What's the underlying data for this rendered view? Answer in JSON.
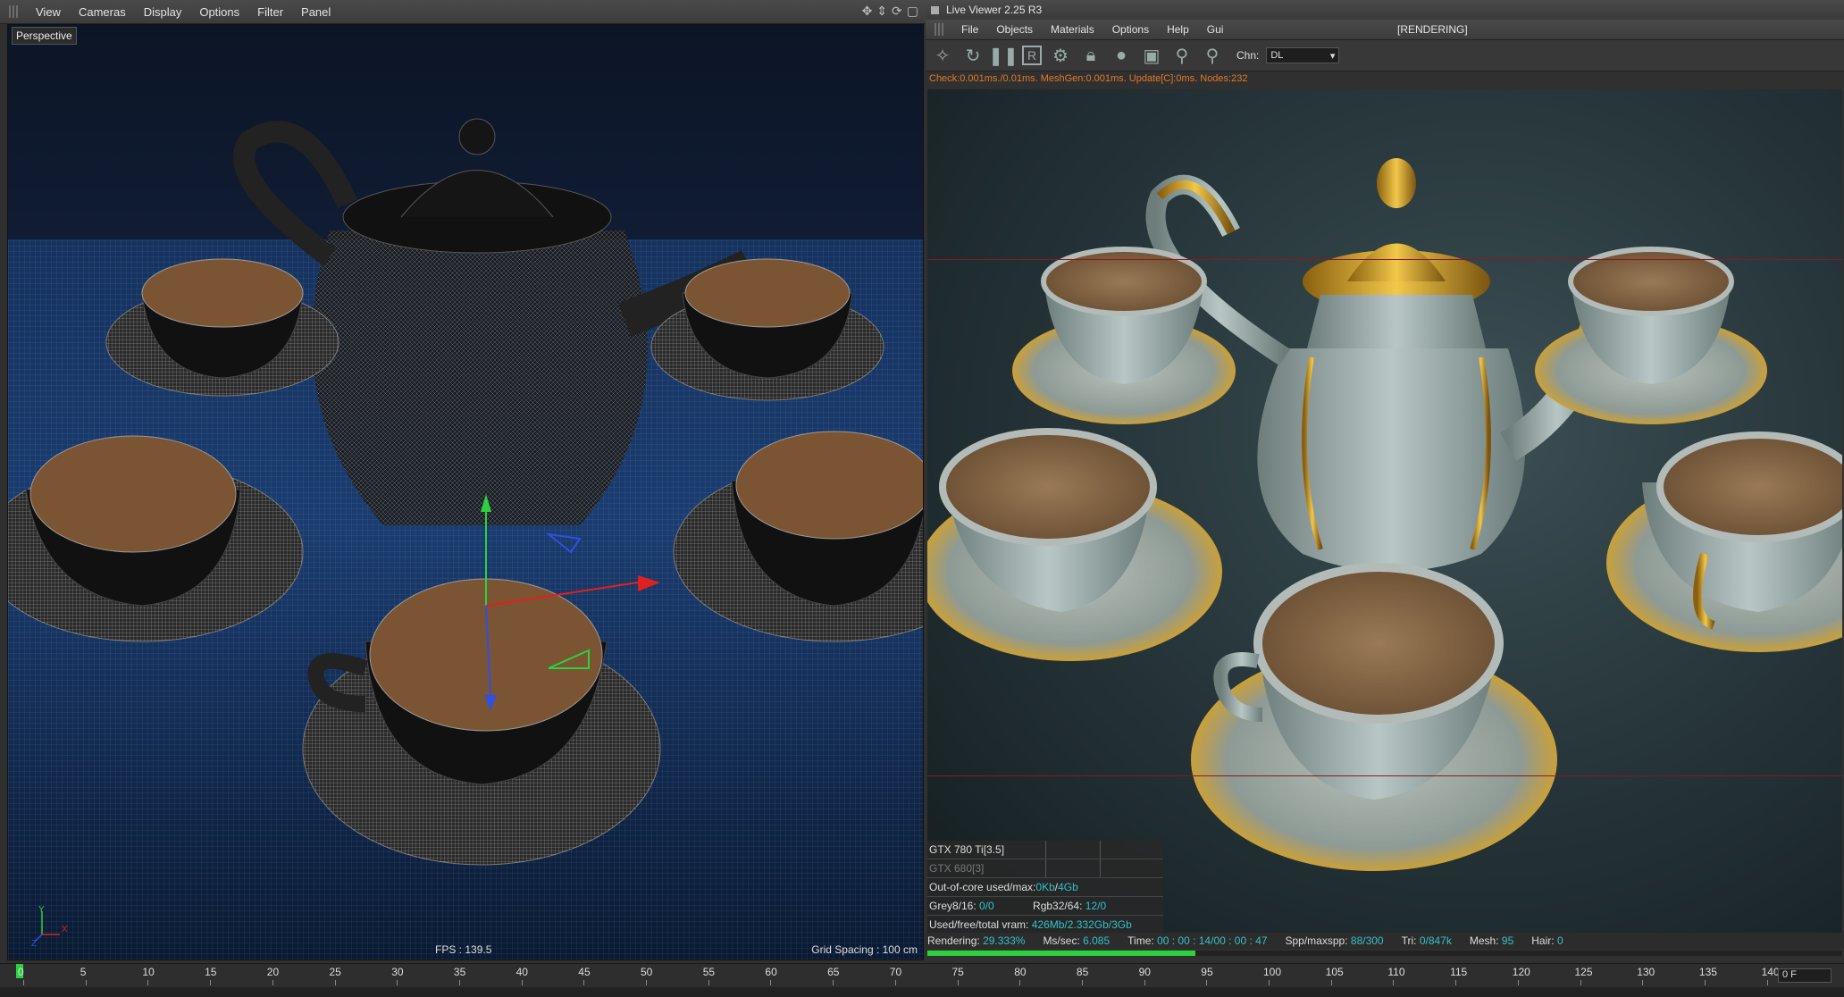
{
  "viewport": {
    "menu": [
      "View",
      "Cameras",
      "Display",
      "Options",
      "Filter",
      "Panel"
    ],
    "label": "Perspective",
    "fps": "FPS : 139.5",
    "grid_spacing": "Grid Spacing : 100 cm",
    "axis_y": "Y",
    "axis_x": "X",
    "axis_z": "Z"
  },
  "live_viewer": {
    "title": "Live Viewer 2.25 R3",
    "menu": [
      "File",
      "Objects",
      "Materials",
      "Options",
      "Help",
      "Gui"
    ],
    "status": "[RENDERING]",
    "chn_label": "Chn:",
    "chn_value": "DL",
    "info_line": "Check:0.001ms./0.01ms. MeshGen:0.001ms. Update[C]:0ms. Nodes:232",
    "gpu": [
      {
        "label": "GTX 780 Ti[3.5]"
      },
      {
        "label": "GTX 680[3]"
      }
    ],
    "mem": {
      "ooc_label": "Out-of-core used/max:",
      "ooc_used": "0Kb",
      "ooc_sep": "/",
      "ooc_max": "4Gb",
      "grey_label": "Grey8/16:",
      "grey_value": "0/0",
      "rgb_label": "Rgb32/64:",
      "rgb_value": "12/0",
      "vram_label": "Used/free/total vram:",
      "vram_value": "426Mb/2.332Gb/3Gb"
    },
    "status_bar": {
      "rendering_label": "Rendering:",
      "rendering_value": "29.333%",
      "ms_label": "Ms/sec:",
      "ms_value": "6.085",
      "time_label": "Time:",
      "time_value": "00 : 00 : 14/00 : 00 : 47",
      "spp_label": "Spp/maxspp:",
      "spp_value": "88/300",
      "tri_label": "Tri:",
      "tri_value": "0/847k",
      "mesh_label": "Mesh:",
      "mesh_value": "95",
      "hair_label": "Hair:",
      "hair_value": "0"
    },
    "progress": 0.29333
  },
  "timeline": {
    "ticks": [
      "0",
      "5",
      "10",
      "15",
      "20",
      "25",
      "30",
      "35",
      "40",
      "45",
      "50",
      "55",
      "60",
      "65",
      "70",
      "75",
      "80",
      "85",
      "90",
      "95",
      "100",
      "105",
      "110",
      "115",
      "120",
      "125",
      "130",
      "135",
      "140"
    ],
    "frame": "0 F"
  },
  "colors": {
    "accent_green": "#2bd23e",
    "highlight_cyan": "#35c1c8",
    "info_orange": "#e07a28"
  }
}
